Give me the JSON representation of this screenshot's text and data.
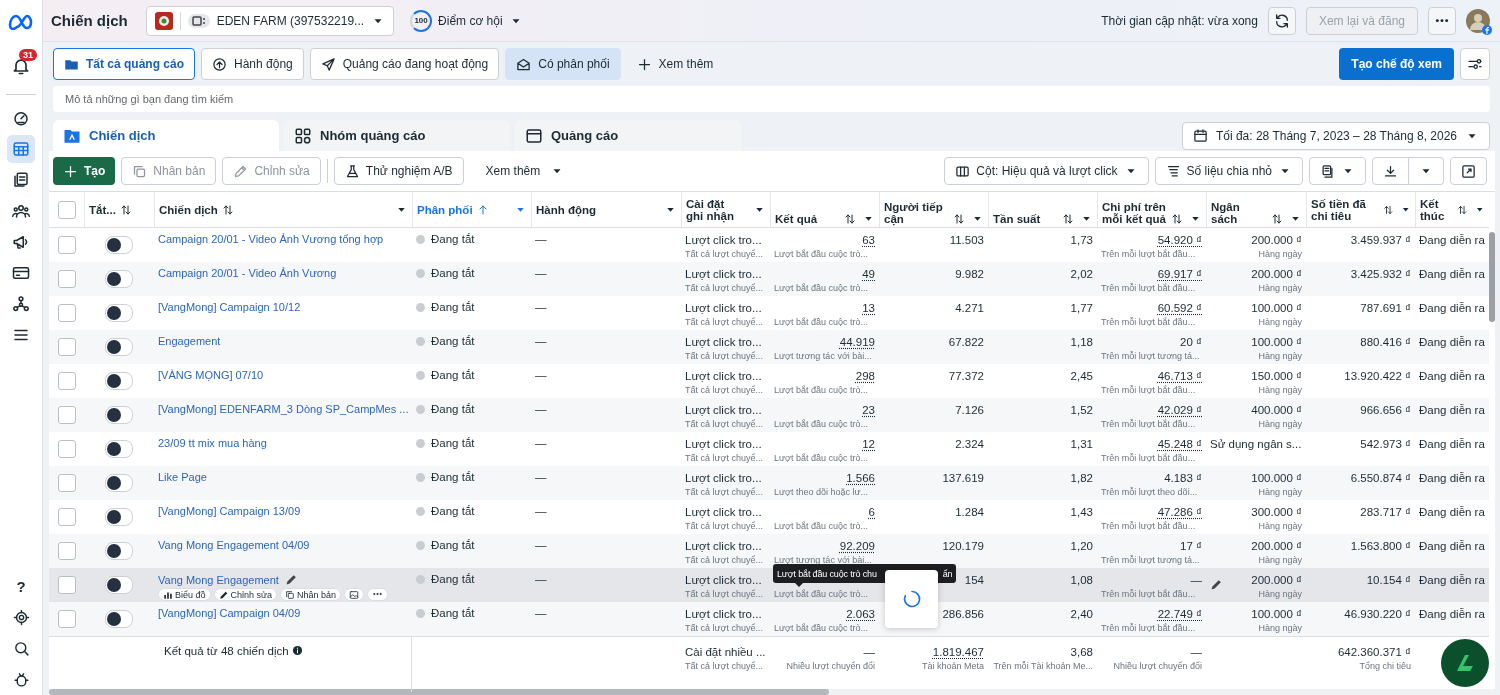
{
  "header": {
    "title": "Chiến dịch",
    "account": "EDEN FARM (397532219...",
    "score": "100",
    "score_label": "Điểm cơ hội",
    "updated": "Thời gian cập nhật: vừa xong",
    "review_button": {
      "label": "Xem lại và đăng",
      "disabled": true
    }
  },
  "sidebar": {
    "notification_count": "31",
    "help": "?",
    "items": [
      {
        "selected": false
      },
      {
        "selected": true
      },
      {
        "selected": false
      },
      {
        "selected": false
      },
      {
        "selected": false
      },
      {
        "selected": false
      },
      {
        "selected": false
      },
      {
        "selected": false
      }
    ]
  },
  "filters": [
    {
      "label": "Tất cả quảng cáo",
      "selected": true,
      "applied": false
    },
    {
      "label": "Hành động",
      "selected": false,
      "applied": false
    },
    {
      "label": "Quảng cáo đang hoạt động",
      "selected": false,
      "applied": false
    },
    {
      "label": "Có phân phối",
      "selected": false,
      "applied": true
    }
  ],
  "more_filters": "Xem thêm",
  "create_view": "Tạo chế độ xem",
  "search": {
    "placeholder": "Mô tả những gì bạn đang tìm kiếm"
  },
  "level_tabs": [
    {
      "label": "Chiến dịch",
      "selected": true
    },
    {
      "label": "Nhóm quảng cáo",
      "selected": false
    },
    {
      "label": "Quảng cáo",
      "selected": false
    }
  ],
  "date_range": "Tối đa: 28 Tháng 7, 2023 – 28 Tháng 8, 2026",
  "toolbar": {
    "left": [
      {
        "label": "Tạo",
        "kind": "primary",
        "disabled": false
      },
      {
        "label": "Nhân bản",
        "kind": "outline",
        "disabled": true
      },
      {
        "label": "Chỉnh sửa",
        "kind": "outline",
        "disabled": true
      },
      {
        "label": "Thử nghiệm A/B",
        "kind": "outline",
        "disabled": false
      },
      {
        "label": "Xem thêm",
        "kind": "menu",
        "disabled": false
      }
    ],
    "columns": "Cột: Hiệu quả và lượt click",
    "breakdown": "Số liệu chia nhỏ"
  },
  "table": {
    "select_all": false,
    "columns": [
      {
        "label": "Tắt...",
        "sortable": true,
        "sorted": false,
        "menu": false
      },
      {
        "label": "Chiến dịch",
        "sortable": true,
        "sorted": false,
        "menu": true
      },
      {
        "label": "Phân phối",
        "sortable": true,
        "sorted": true,
        "menu": true
      },
      {
        "label": "Hành động",
        "sortable": false,
        "sorted": false,
        "menu": true
      },
      {
        "label": "Cài đặt ghi nhận",
        "sortable": false,
        "sorted": false,
        "menu": true
      },
      {
        "label": "Kết quả",
        "sortable": true,
        "sorted": false,
        "menu": true
      },
      {
        "label": "Người tiếp cận",
        "sortable": true,
        "sorted": false,
        "menu": true
      },
      {
        "label": "Tần suất",
        "sortable": true,
        "sorted": false,
        "menu": true
      },
      {
        "label": "Chi phí trên mỗi kết quả",
        "sortable": true,
        "sorted": false,
        "menu": true
      },
      {
        "label": "Ngân sách",
        "sortable": true,
        "sorted": false,
        "menu": true
      },
      {
        "label": "Số tiền đã chi tiêu",
        "sortable": true,
        "sorted": false,
        "menu": true
      },
      {
        "label": "Kết thúc",
        "sortable": true,
        "sorted": false,
        "menu": true
      }
    ],
    "rows": [
      {
        "checked": false,
        "on": false,
        "highlighted": false,
        "name": "Campaign 20/01 - Video Ảnh Vương tổng hợp",
        "delivery": "Đang tắt",
        "actions": "—",
        "attribution": "Lượt click tro...",
        "attribution_sub": "Tất cả lượt chuyể...",
        "result": "63",
        "result_sub": "Lượt bắt đầu cuộc trò...",
        "reach": "11.503",
        "frequency": "1,73",
        "cost": "54.920 ₫",
        "cost_underlined": true,
        "cost_sub": "Trên mỗi lượt bắt đầu...",
        "budget": "200.000 ₫",
        "budget_sub": "Hàng ngày",
        "spent": "3.459.937 ₫",
        "end": "Đang diễn ra"
      },
      {
        "checked": false,
        "on": false,
        "highlighted": false,
        "name": "Campaign 20/01 - Video Ảnh Vương",
        "delivery": "Đang tắt",
        "actions": "—",
        "attribution": "Lượt click tro...",
        "attribution_sub": "Tất cả lượt chuyể...",
        "result": "49",
        "result_sub": "Lượt bắt đầu cuộc trò...",
        "reach": "9.982",
        "frequency": "2,02",
        "cost": "69.917 ₫",
        "cost_underlined": true,
        "cost_sub": "Trên mỗi lượt bắt đầu...",
        "budget": "200.000 ₫",
        "budget_sub": "Hàng ngày",
        "spent": "3.425.932 ₫",
        "end": "Đang diễn ra"
      },
      {
        "checked": false,
        "on": false,
        "highlighted": false,
        "name": "[VangMong] Campaign 10/12",
        "delivery": "Đang tắt",
        "actions": "—",
        "attribution": "Lượt click tro...",
        "attribution_sub": "Tất cả lượt chuyể...",
        "result": "13",
        "result_sub": "Lượt bắt đầu cuộc trò...",
        "reach": "4.271",
        "frequency": "1,77",
        "cost": "60.592 ₫",
        "cost_underlined": true,
        "cost_sub": "Trên mỗi lượt bắt đầu...",
        "budget": "100.000 ₫",
        "budget_sub": "Hàng ngày",
        "spent": "787.691 ₫",
        "end": "Đang diễn ra"
      },
      {
        "checked": false,
        "on": false,
        "highlighted": false,
        "name": "Engagement",
        "delivery": "Đang tắt",
        "actions": "—",
        "attribution": "Lượt click tro...",
        "attribution_sub": "Tất cả lượt chuyể...",
        "result": "44.919",
        "result_sub": "Lượt tương tác với bài...",
        "reach": "67.822",
        "frequency": "1,18",
        "cost": "20 ₫",
        "cost_underlined": false,
        "cost_sub": "Trên mỗi lượt tương tá...",
        "budget": "100.000 ₫",
        "budget_sub": "Hàng ngày",
        "spent": "880.416 ₫",
        "end": "Đang diễn ra"
      },
      {
        "checked": false,
        "on": false,
        "highlighted": false,
        "name": "[VÀNG MỌNG] 07/10",
        "delivery": "Đang tắt",
        "actions": "—",
        "attribution": "Lượt click tro...",
        "attribution_sub": "Tất cả lượt chuyể...",
        "result": "298",
        "result_sub": "Lượt bắt đầu cuộc trò...",
        "reach": "77.372",
        "frequency": "2,45",
        "cost": "46.713 ₫",
        "cost_underlined": true,
        "cost_sub": "Trên mỗi lượt bắt đầu...",
        "budget": "150.000 ₫",
        "budget_sub": "Hàng ngày",
        "spent": "13.920.422 ₫",
        "end": "Đang diễn ra"
      },
      {
        "checked": false,
        "on": false,
        "highlighted": false,
        "name": "[VangMong] EDENFARM_3 Dòng SP_CampMes ...",
        "delivery": "Đang tắt",
        "actions": "—",
        "attribution": "Lượt click tro...",
        "attribution_sub": "Tất cả lượt chuyể...",
        "result": "23",
        "result_sub": "Lượt bắt đầu cuộc trò...",
        "reach": "7.126",
        "frequency": "1,52",
        "cost": "42.029 ₫",
        "cost_underlined": true,
        "cost_sub": "Trên mỗi lượt bắt đầu...",
        "budget": "400.000 ₫",
        "budget_sub": "Hàng ngày",
        "spent": "966.656 ₫",
        "end": "Đang diễn ra"
      },
      {
        "checked": false,
        "on": false,
        "highlighted": false,
        "name": "23/09 tt mix mua hàng",
        "delivery": "Đang tắt",
        "actions": "—",
        "attribution": "Lượt click tro...",
        "attribution_sub": "Tất cả lượt chuyể...",
        "result": "12",
        "result_sub": "Lượt bắt đầu cuộc trò...",
        "reach": "2.324",
        "frequency": "1,31",
        "cost": "45.248 ₫",
        "cost_underlined": true,
        "cost_sub": "Trên mỗi lượt bắt đầu...",
        "budget": "Sử dụng ngân s...",
        "spent": "542.973 ₫",
        "end": "Đang diễn ra"
      },
      {
        "checked": false,
        "on": false,
        "highlighted": false,
        "name": "Like Page",
        "delivery": "Đang tắt",
        "actions": "—",
        "attribution": "Lượt click tro...",
        "attribution_sub": "Tất cả lượt chuyể...",
        "result": "1.566",
        "result_sub": "Lượt theo dõi hoặc lư...",
        "reach": "137.619",
        "frequency": "1,82",
        "cost": "4.183 ₫",
        "cost_underlined": false,
        "cost_sub": "Trên mỗi lượt theo dõi...",
        "budget": "100.000 ₫",
        "budget_sub": "Hàng ngày",
        "spent": "6.550.874 ₫",
        "end": "Đang diễn ra"
      },
      {
        "checked": false,
        "on": false,
        "highlighted": false,
        "name": "[VangMong] Campaign 13/09",
        "delivery": "Đang tắt",
        "actions": "—",
        "attribution": "Lượt click tro...",
        "attribution_sub": "Tất cả lượt chuyể...",
        "result": "6",
        "result_sub": "Lượt bắt đầu cuộc trò...",
        "reach": "1.284",
        "frequency": "1,43",
        "cost": "47.286 ₫",
        "cost_underlined": true,
        "cost_sub": "Trên mỗi lượt bắt đầu...",
        "budget": "300.000 ₫",
        "budget_sub": "Hàng ngày",
        "spent": "283.717 ₫",
        "end": "Đang diễn ra"
      },
      {
        "checked": false,
        "on": false,
        "highlighted": false,
        "name": "Vang Mong Engagement 04/09",
        "delivery": "Đang tắt",
        "actions": "—",
        "attribution": "Lượt click tro...",
        "attribution_sub": "Tất cả lượt chuyể...",
        "result": "92.209",
        "result_sub": "Lượt tương tác với bài...",
        "reach": "120.179",
        "frequency": "1,20",
        "cost": "17 ₫",
        "cost_underlined": false,
        "cost_sub": "Trên mỗi lượt tương tá...",
        "budget": "200.000 ₫",
        "budget_sub": "Hàng ngày",
        "spent": "1.563.800 ₫",
        "end": "Đang diễn ra"
      },
      {
        "checked": false,
        "on": false,
        "highlighted": true,
        "name": "Vang Mong Engagement",
        "hover_actions": [
          "Biểu đồ",
          "Chỉnh sửa",
          "Nhân bản"
        ],
        "delivery": "Đang tắt",
        "actions": "—",
        "attribution": "Lượt click tro...",
        "attribution_sub": "Tất cả lượt chuyể...",
        "result_sub": "Lượt bắt đầu cuộc trò...",
        "reach": "154",
        "frequency": "1,08",
        "cost": "—",
        "cost_underlined": false,
        "cost_sub": "Trên mỗi lượt bắt đầu...",
        "budget": "200.000 ₫",
        "budget_sub": "Hàng ngày",
        "spent": "10.154 ₫",
        "end": "Đang diễn ra"
      },
      {
        "checked": false,
        "on": false,
        "highlighted": false,
        "name": "[VangMong] Campaign 04/09",
        "delivery": "Đang tắt",
        "actions": "—",
        "attribution": "Lượt click tro...",
        "attribution_sub": "Tất cả lượt chuyể...",
        "result": "2.063",
        "result_sub": "Lượt bắt đầu cuộc trò...",
        "reach": "286.856",
        "frequency": "2,40",
        "cost": "22.749 ₫",
        "cost_underlined": true,
        "cost_sub": "Trên mỗi lượt bắt đầu...",
        "budget": "100.000 ₫",
        "budget_sub": "Hàng ngày",
        "spent": "46.930.220 ₫",
        "end": "Đang diễn ra"
      }
    ],
    "footer": {
      "summary": "Kết quả từ 48 chiến dịch",
      "attribution": "Cài đặt nhiều ...",
      "attribution_sub": "Tất cả lượt chuyể...",
      "result": "—",
      "result_sub": "Nhiều lượt chuyển đổi",
      "reach": "1.819.467",
      "reach_sub": "Tài khoản Meta",
      "frequency": "3,68",
      "frequency_sub": "Trên mỗi Tài khoản Me...",
      "cost": "—",
      "cost_sub": "Nhiều lượt chuyển đổi",
      "spent": "642.360.371 ₫",
      "spent_sub": "Tổng chi tiêu"
    },
    "tooltip": [
      "Lượt bắt đầu cuộc trò chu",
      "ẩn"
    ]
  }
}
